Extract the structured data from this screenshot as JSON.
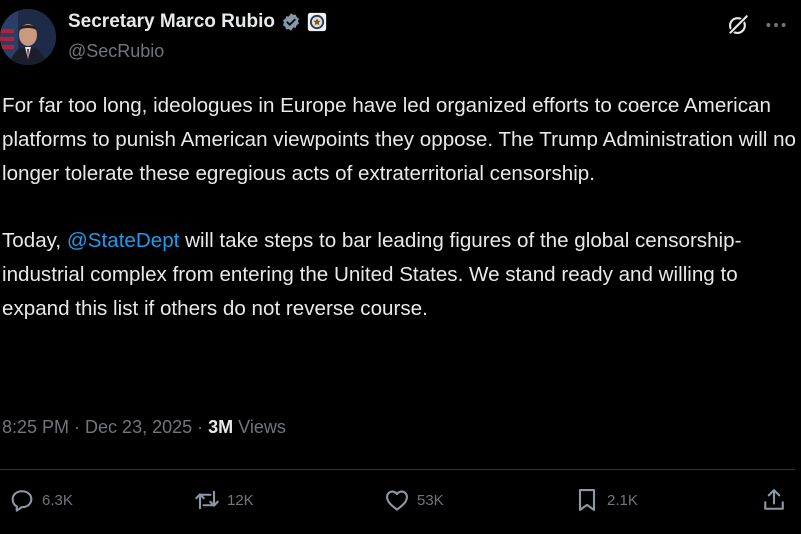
{
  "author": {
    "display_name": "Secretary Marco Rubio",
    "handle": "@SecRubio",
    "avatar_icon": "portrait-avatar",
    "verified_badge_color": "#829aab",
    "affiliation_icon": "state-department-seal-icon"
  },
  "top_actions": {
    "grok_icon": "grok-icon",
    "more_icon": "more-dots-icon"
  },
  "post": {
    "paragraph1": "For far too long, ideologues in Europe have led organized efforts to coerce American platforms to punish American viewpoints they oppose. The Trump Administration will no longer tolerate these egregious acts of extraterritorial censorship.",
    "paragraph2_before": "Today, ",
    "paragraph2_mention": "@StateDept",
    "paragraph2_after": " will take steps to bar leading figures of the global censorship-industrial complex from entering the United States. We stand ready and willing to expand this list if others do not reverse course."
  },
  "meta": {
    "time": "8:25 PM",
    "separator": " · ",
    "date": "Dec 23, 2025",
    "views_count": "3M",
    "views_label": " Views"
  },
  "actions": {
    "replies": "6.3K",
    "reposts": "12K",
    "likes": "53K",
    "bookmarks": "2.1K"
  },
  "colors": {
    "background": "#000000",
    "text": "#e7e9ea",
    "secondary": "#71767b",
    "link": "#1d9bf0",
    "divider": "#2f3336"
  }
}
